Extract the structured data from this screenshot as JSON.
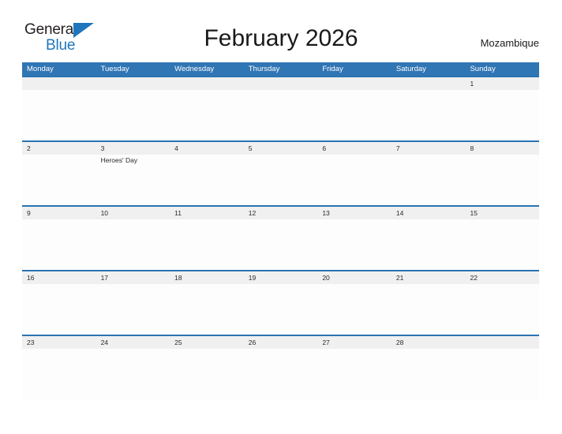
{
  "brand": {
    "name_part1": "General",
    "name_part2": "Blue",
    "flag_icon": "blue-triangle-flag-icon",
    "accent_color": "#1f76bc"
  },
  "header": {
    "title": "February 2026",
    "country": "Mozambique"
  },
  "colors": {
    "header_blue": "#3075b4",
    "row_divider_blue": "#2a74b2",
    "date_band_gray": "#f0f0f0",
    "brand_blue": "#1f76bc",
    "text": "#222222"
  },
  "calendar": {
    "month": "February",
    "year": "2026",
    "weekday_headers": [
      "Monday",
      "Tuesday",
      "Wednesday",
      "Thursday",
      "Friday",
      "Saturday",
      "Sunday"
    ],
    "weeks": [
      {
        "dates": [
          "",
          "",
          "",
          "",
          "",
          "",
          "1"
        ],
        "events": [
          "",
          "",
          "",
          "",
          "",
          "",
          ""
        ]
      },
      {
        "dates": [
          "2",
          "3",
          "4",
          "5",
          "6",
          "7",
          "8"
        ],
        "events": [
          "",
          "Heroes' Day",
          "",
          "",
          "",
          "",
          ""
        ]
      },
      {
        "dates": [
          "9",
          "10",
          "11",
          "12",
          "13",
          "14",
          "15"
        ],
        "events": [
          "",
          "",
          "",
          "",
          "",
          "",
          ""
        ]
      },
      {
        "dates": [
          "16",
          "17",
          "18",
          "19",
          "20",
          "21",
          "22"
        ],
        "events": [
          "",
          "",
          "",
          "",
          "",
          "",
          ""
        ]
      },
      {
        "dates": [
          "23",
          "24",
          "25",
          "26",
          "27",
          "28",
          ""
        ],
        "events": [
          "",
          "",
          "",
          "",
          "",
          "",
          ""
        ]
      }
    ]
  }
}
